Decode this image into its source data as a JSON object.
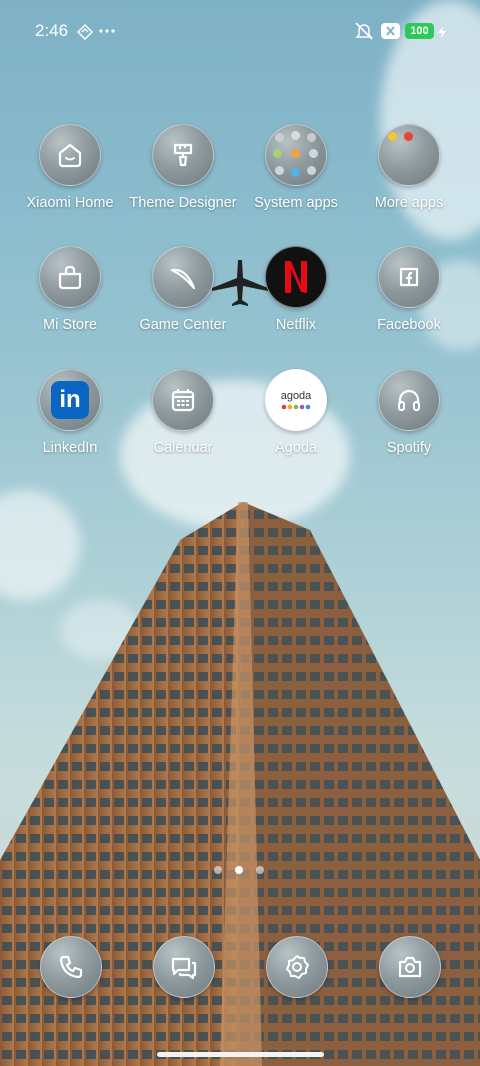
{
  "status_bar": {
    "time": "2:46",
    "battery": "100",
    "battery_color": "#2fc85b"
  },
  "apps": [
    {
      "label": "Xiaomi Home",
      "icon": "house-icon"
    },
    {
      "label": "Theme Designer",
      "icon": "paint-roller-icon"
    },
    {
      "label": "System apps",
      "icon": "folder-icon"
    },
    {
      "label": "More apps",
      "icon": "folder-icon"
    },
    {
      "label": "Mi Store",
      "icon": "shopping-bag-icon"
    },
    {
      "label": "Game Center",
      "icon": "boomerang-icon"
    },
    {
      "label": "Netflix",
      "icon": "netflix-logo"
    },
    {
      "label": "Facebook",
      "icon": "facebook-logo"
    },
    {
      "label": "LinkedIn",
      "icon": "linkedin-logo"
    },
    {
      "label": "Calendar",
      "icon": "calendar-icon"
    },
    {
      "label": "Agoda",
      "icon": "agoda-logo",
      "logo_text": "agoda"
    },
    {
      "label": "Spotify",
      "icon": "headphones-icon"
    }
  ],
  "page_indicator": {
    "pages": 3,
    "active": 2
  },
  "dock": [
    {
      "icon": "phone-icon"
    },
    {
      "icon": "messages-icon"
    },
    {
      "icon": "settings-gear-icon"
    },
    {
      "icon": "camera-icon"
    }
  ],
  "colors": {
    "netflix_red": "#e50914",
    "linkedin_blue": "#0a66c2"
  }
}
